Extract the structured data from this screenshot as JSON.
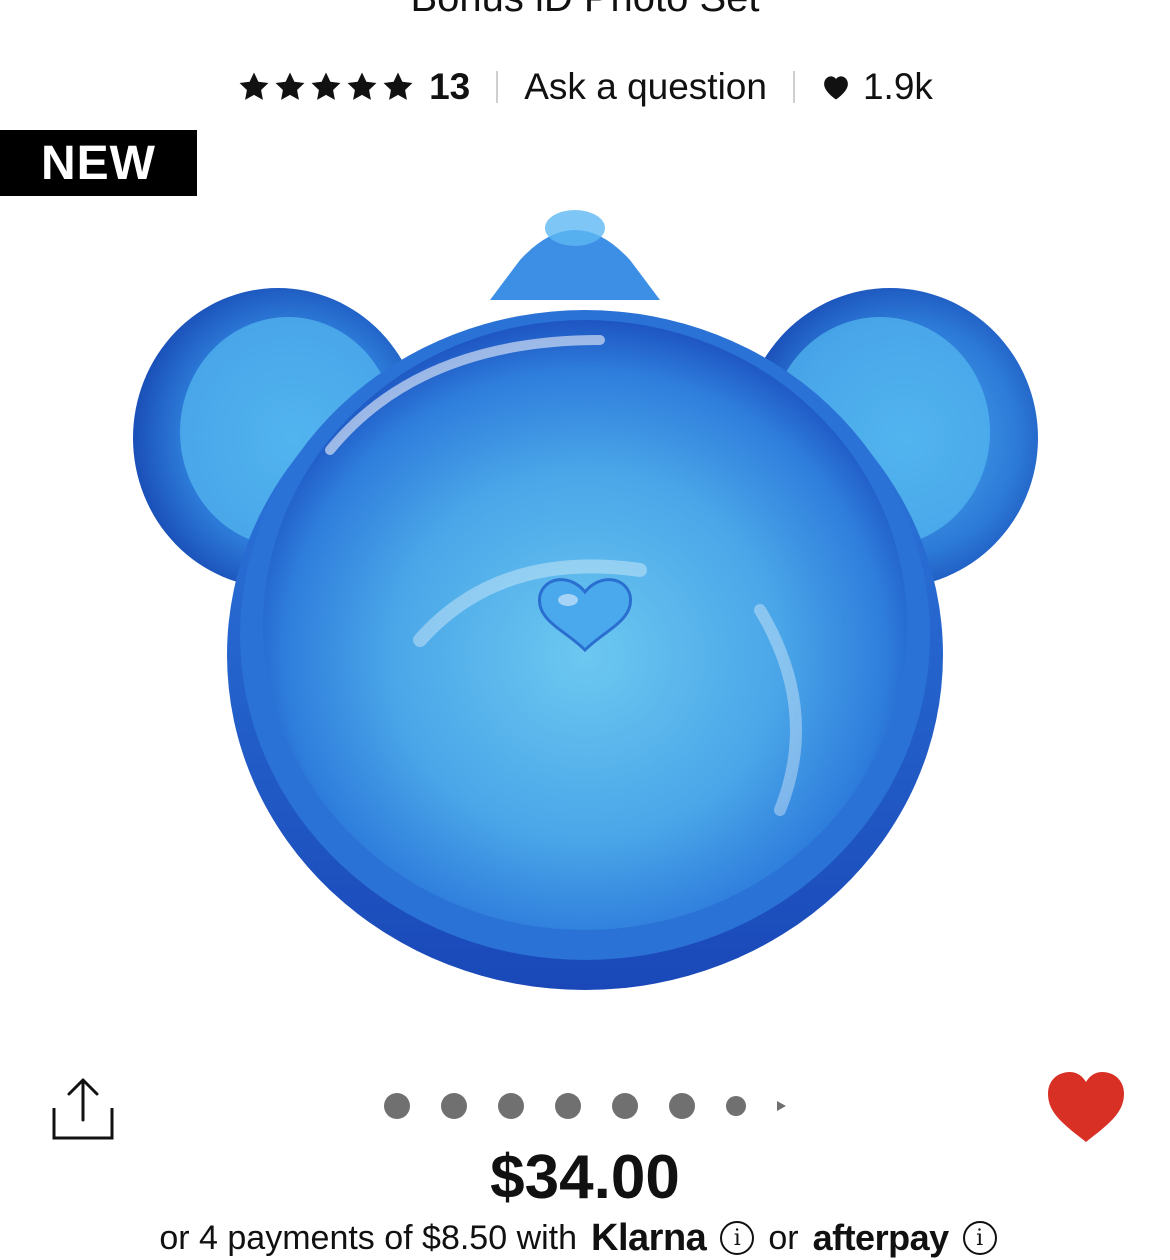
{
  "product": {
    "title": "Bonus iD Photo Set",
    "rating_stars": 5,
    "review_count": "13",
    "ask_question": "Ask a question",
    "loves_count": "1.9k",
    "badge": "NEW",
    "price": "$34.00",
    "installment_prefix": "or 4 payments of $8.50 with",
    "klarna_label": "Klarna",
    "or_label": "or",
    "afterpay_label": "afterpay"
  },
  "carousel": {
    "total_dots": 8
  },
  "colors": {
    "heart_active": "#d93025",
    "badge_bg": "#000000",
    "product_blue": "#2f7fe0"
  },
  "icons": {
    "share": "share-icon",
    "favorite": "heart-icon",
    "star": "star-icon",
    "info": "info-icon"
  }
}
